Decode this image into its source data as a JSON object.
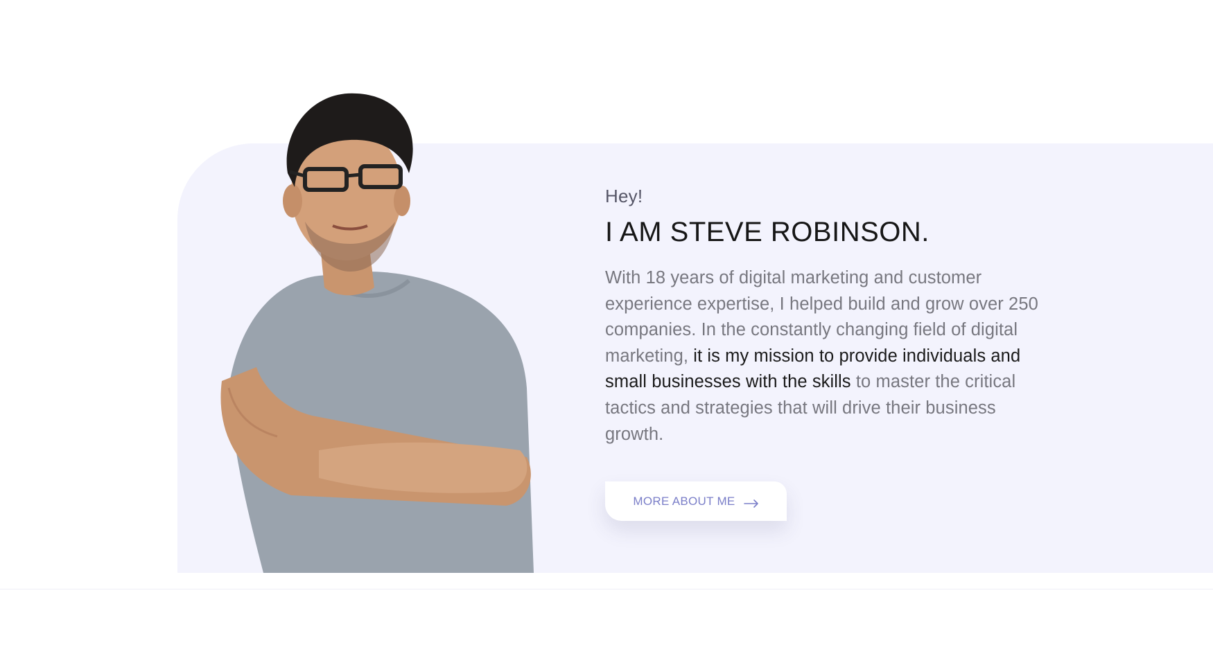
{
  "hero": {
    "greeting": "Hey!",
    "name_heading": "I AM STEVE ROBINSON.",
    "bio_part1": "With 18 years of digital marketing and customer experience expertise, I helped build and grow over 250 companies. In the constantly changing field of digital marketing, ",
    "bio_emphasis": "it is my mission to provide individuals and small businesses with the skills",
    "bio_part2": " to master the critical tactics and strategies that will drive their business growth.",
    "cta_label": "MORE ABOUT ME",
    "cta_icon": "arrow-right-icon",
    "portrait_alt": "portrait-photo"
  },
  "colors": {
    "panel_bg": "#f3f3fd",
    "heading": "#161616",
    "body_text": "#77777f",
    "accent": "#7a7ec8"
  }
}
